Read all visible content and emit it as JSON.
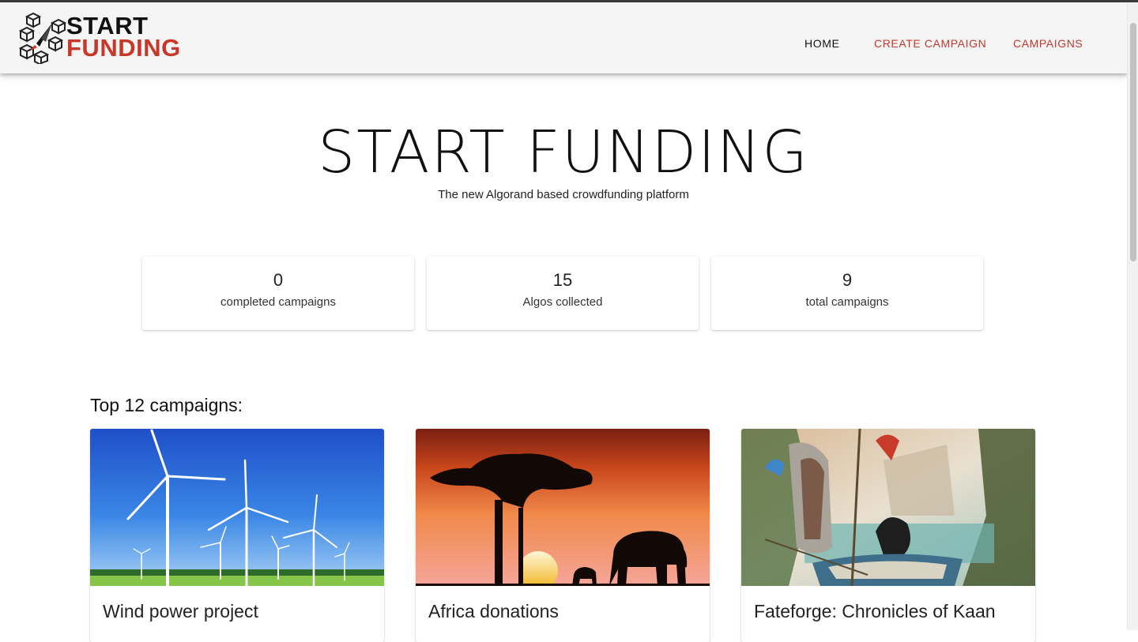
{
  "brand": {
    "line1": "START",
    "line2": "FUNDING"
  },
  "nav": {
    "home": "HOME",
    "create": "CREATE CAMPAIGN",
    "campaigns": "CAMPAIGNS"
  },
  "hero": {
    "title": "START FUNDING",
    "subtitle": "The new Algorand based crowdfunding platform"
  },
  "stats": [
    {
      "value": "0",
      "label": "completed campaigns"
    },
    {
      "value": "15",
      "label": "Algos collected"
    },
    {
      "value": "9",
      "label": "total campaigns"
    }
  ],
  "section": {
    "title": "Top 12 campaigns:"
  },
  "campaigns": [
    {
      "title": "Wind power project"
    },
    {
      "title": "Africa donations"
    },
    {
      "title": "Fateforge: Chronicles of Kaan"
    }
  ],
  "colors": {
    "accent": "#c0392b",
    "header_bg": "#f5f5f5"
  }
}
